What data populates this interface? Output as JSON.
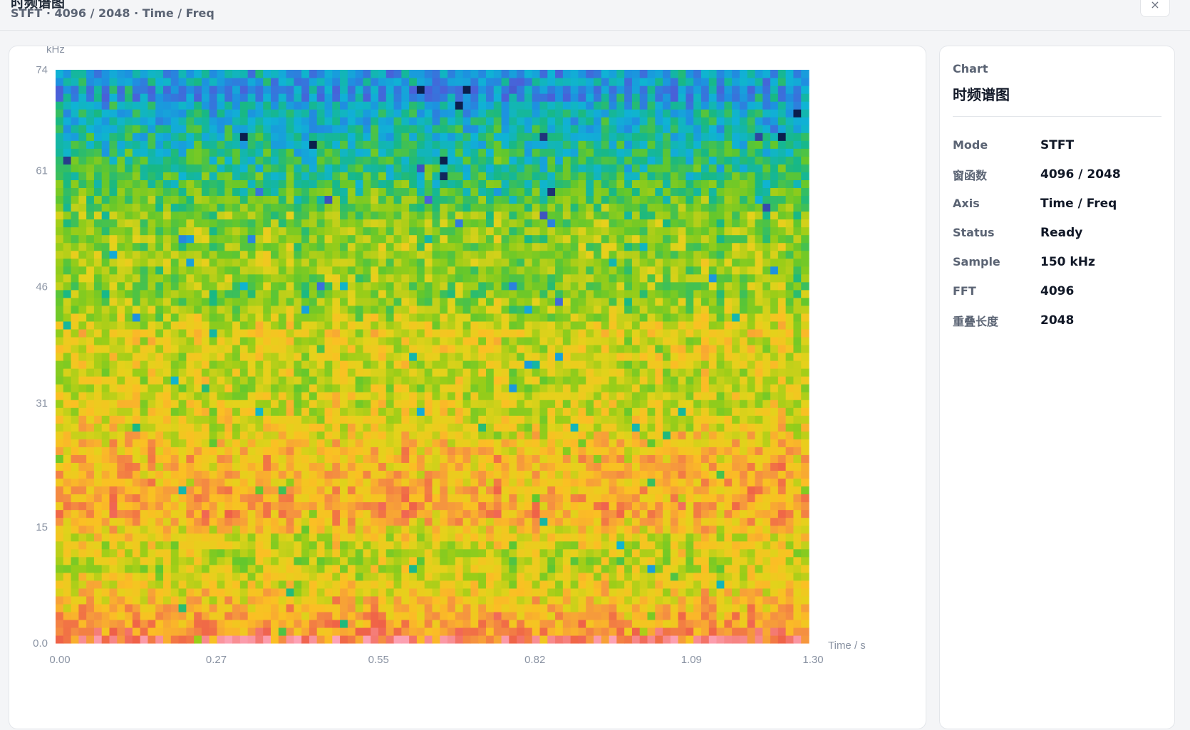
{
  "header": {
    "title": "时频谱图",
    "subtitle": "STFT · 4096 / 2048 · Time / Freq",
    "close_label": "×"
  },
  "panel": {
    "heading": "Chart",
    "title": "时频谱图",
    "rows": [
      {
        "key": "Mode",
        "value": "STFT"
      },
      {
        "key": "窗函数",
        "value": "4096 / 2048"
      },
      {
        "key": "Axis",
        "value": "Time / Freq"
      },
      {
        "key": "Status",
        "value": "Ready"
      },
      {
        "key": "Sample",
        "value": "150 kHz"
      },
      {
        "key": "FFT",
        "value": "4096"
      },
      {
        "key": "重叠长度",
        "value": "2048"
      }
    ]
  },
  "colors": {
    "colormap": [
      "#0b1f4d",
      "#4a5fd8",
      "#1e90e0",
      "#0fb4d4",
      "#18b884",
      "#62c72d",
      "#9acd18",
      "#e4d21b",
      "#fbbf24",
      "#f59340",
      "#ef6048",
      "#fda4b8"
    ]
  },
  "chart_data": {
    "type": "heatmap",
    "title": "",
    "xlabel": "Time / s",
    "ylabel": "kHz",
    "x_ticks": [
      "0.00",
      "0.27",
      "0.55",
      "0.82",
      "1.09",
      "1.30"
    ],
    "y_ticks": [
      "0.0",
      "15",
      "31",
      "46",
      "61",
      "74"
    ],
    "xlim": [
      0,
      1.3
    ],
    "ylim": [
      0,
      74
    ],
    "time_bins": 98,
    "freq_bins": 73,
    "intensity_scale": "0 = low (dark blue) to 1 = high (red/pink)",
    "band_profile": [
      {
        "freq_khz": 0,
        "intensity": 0.86
      },
      {
        "freq_khz": 3,
        "intensity": 0.78
      },
      {
        "freq_khz": 6,
        "intensity": 0.7
      },
      {
        "freq_khz": 10,
        "intensity": 0.58
      },
      {
        "freq_khz": 13,
        "intensity": 0.62
      },
      {
        "freq_khz": 17,
        "intensity": 0.78
      },
      {
        "freq_khz": 21,
        "intensity": 0.74
      },
      {
        "freq_khz": 25,
        "intensity": 0.72
      },
      {
        "freq_khz": 28,
        "intensity": 0.64
      },
      {
        "freq_khz": 33,
        "intensity": 0.6
      },
      {
        "freq_khz": 40,
        "intensity": 0.63
      },
      {
        "freq_khz": 45,
        "intensity": 0.5
      },
      {
        "freq_khz": 49,
        "intensity": 0.54
      },
      {
        "freq_khz": 55,
        "intensity": 0.5
      },
      {
        "freq_khz": 60,
        "intensity": 0.4
      },
      {
        "freq_khz": 66,
        "intensity": 0.31
      },
      {
        "freq_khz": 70,
        "intensity": 0.26
      },
      {
        "freq_khz": 74,
        "intensity": 0.22
      }
    ],
    "stripe_band_khz": [
      70,
      72
    ],
    "stripe_intensity": 0.12
  }
}
